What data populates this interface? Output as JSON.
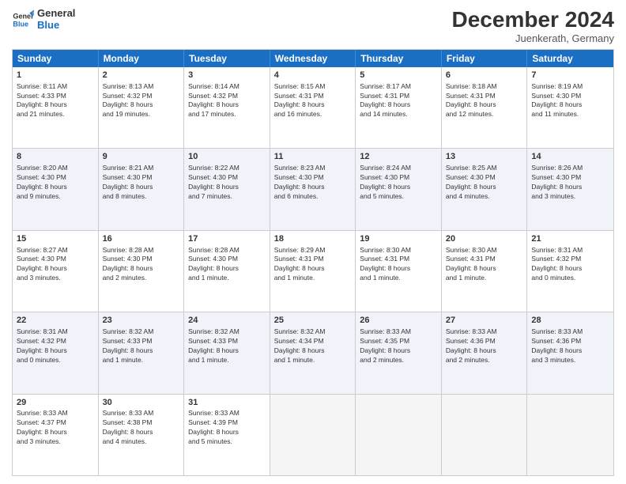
{
  "logo": {
    "line1": "General",
    "line2": "Blue"
  },
  "title": "December 2024",
  "subtitle": "Juenkerath, Germany",
  "days": [
    "Sunday",
    "Monday",
    "Tuesday",
    "Wednesday",
    "Thursday",
    "Friday",
    "Saturday"
  ],
  "rows": [
    [
      {
        "num": "1",
        "text": "Sunrise: 8:11 AM\nSunset: 4:33 PM\nDaylight: 8 hours\nand 21 minutes.",
        "alt": false
      },
      {
        "num": "2",
        "text": "Sunrise: 8:13 AM\nSunset: 4:32 PM\nDaylight: 8 hours\nand 19 minutes.",
        "alt": false
      },
      {
        "num": "3",
        "text": "Sunrise: 8:14 AM\nSunset: 4:32 PM\nDaylight: 8 hours\nand 17 minutes.",
        "alt": false
      },
      {
        "num": "4",
        "text": "Sunrise: 8:15 AM\nSunset: 4:31 PM\nDaylight: 8 hours\nand 16 minutes.",
        "alt": false
      },
      {
        "num": "5",
        "text": "Sunrise: 8:17 AM\nSunset: 4:31 PM\nDaylight: 8 hours\nand 14 minutes.",
        "alt": false
      },
      {
        "num": "6",
        "text": "Sunrise: 8:18 AM\nSunset: 4:31 PM\nDaylight: 8 hours\nand 12 minutes.",
        "alt": false
      },
      {
        "num": "7",
        "text": "Sunrise: 8:19 AM\nSunset: 4:30 PM\nDaylight: 8 hours\nand 11 minutes.",
        "alt": false
      }
    ],
    [
      {
        "num": "8",
        "text": "Sunrise: 8:20 AM\nSunset: 4:30 PM\nDaylight: 8 hours\nand 9 minutes.",
        "alt": true
      },
      {
        "num": "9",
        "text": "Sunrise: 8:21 AM\nSunset: 4:30 PM\nDaylight: 8 hours\nand 8 minutes.",
        "alt": true
      },
      {
        "num": "10",
        "text": "Sunrise: 8:22 AM\nSunset: 4:30 PM\nDaylight: 8 hours\nand 7 minutes.",
        "alt": true
      },
      {
        "num": "11",
        "text": "Sunrise: 8:23 AM\nSunset: 4:30 PM\nDaylight: 8 hours\nand 6 minutes.",
        "alt": true
      },
      {
        "num": "12",
        "text": "Sunrise: 8:24 AM\nSunset: 4:30 PM\nDaylight: 8 hours\nand 5 minutes.",
        "alt": true
      },
      {
        "num": "13",
        "text": "Sunrise: 8:25 AM\nSunset: 4:30 PM\nDaylight: 8 hours\nand 4 minutes.",
        "alt": true
      },
      {
        "num": "14",
        "text": "Sunrise: 8:26 AM\nSunset: 4:30 PM\nDaylight: 8 hours\nand 3 minutes.",
        "alt": true
      }
    ],
    [
      {
        "num": "15",
        "text": "Sunrise: 8:27 AM\nSunset: 4:30 PM\nDaylight: 8 hours\nand 3 minutes.",
        "alt": false
      },
      {
        "num": "16",
        "text": "Sunrise: 8:28 AM\nSunset: 4:30 PM\nDaylight: 8 hours\nand 2 minutes.",
        "alt": false
      },
      {
        "num": "17",
        "text": "Sunrise: 8:28 AM\nSunset: 4:30 PM\nDaylight: 8 hours\nand 1 minute.",
        "alt": false
      },
      {
        "num": "18",
        "text": "Sunrise: 8:29 AM\nSunset: 4:31 PM\nDaylight: 8 hours\nand 1 minute.",
        "alt": false
      },
      {
        "num": "19",
        "text": "Sunrise: 8:30 AM\nSunset: 4:31 PM\nDaylight: 8 hours\nand 1 minute.",
        "alt": false
      },
      {
        "num": "20",
        "text": "Sunrise: 8:30 AM\nSunset: 4:31 PM\nDaylight: 8 hours\nand 1 minute.",
        "alt": false
      },
      {
        "num": "21",
        "text": "Sunrise: 8:31 AM\nSunset: 4:32 PM\nDaylight: 8 hours\nand 0 minutes.",
        "alt": false
      }
    ],
    [
      {
        "num": "22",
        "text": "Sunrise: 8:31 AM\nSunset: 4:32 PM\nDaylight: 8 hours\nand 0 minutes.",
        "alt": true
      },
      {
        "num": "23",
        "text": "Sunrise: 8:32 AM\nSunset: 4:33 PM\nDaylight: 8 hours\nand 1 minute.",
        "alt": true
      },
      {
        "num": "24",
        "text": "Sunrise: 8:32 AM\nSunset: 4:33 PM\nDaylight: 8 hours\nand 1 minute.",
        "alt": true
      },
      {
        "num": "25",
        "text": "Sunrise: 8:32 AM\nSunset: 4:34 PM\nDaylight: 8 hours\nand 1 minute.",
        "alt": true
      },
      {
        "num": "26",
        "text": "Sunrise: 8:33 AM\nSunset: 4:35 PM\nDaylight: 8 hours\nand 2 minutes.",
        "alt": true
      },
      {
        "num": "27",
        "text": "Sunrise: 8:33 AM\nSunset: 4:36 PM\nDaylight: 8 hours\nand 2 minutes.",
        "alt": true
      },
      {
        "num": "28",
        "text": "Sunrise: 8:33 AM\nSunset: 4:36 PM\nDaylight: 8 hours\nand 3 minutes.",
        "alt": true
      }
    ],
    [
      {
        "num": "29",
        "text": "Sunrise: 8:33 AM\nSunset: 4:37 PM\nDaylight: 8 hours\nand 3 minutes.",
        "alt": false
      },
      {
        "num": "30",
        "text": "Sunrise: 8:33 AM\nSunset: 4:38 PM\nDaylight: 8 hours\nand 4 minutes.",
        "alt": false
      },
      {
        "num": "31",
        "text": "Sunrise: 8:33 AM\nSunset: 4:39 PM\nDaylight: 8 hours\nand 5 minutes.",
        "alt": false
      },
      {
        "num": "",
        "text": "",
        "alt": false,
        "empty": true
      },
      {
        "num": "",
        "text": "",
        "alt": false,
        "empty": true
      },
      {
        "num": "",
        "text": "",
        "alt": false,
        "empty": true
      },
      {
        "num": "",
        "text": "",
        "alt": false,
        "empty": true
      }
    ]
  ]
}
